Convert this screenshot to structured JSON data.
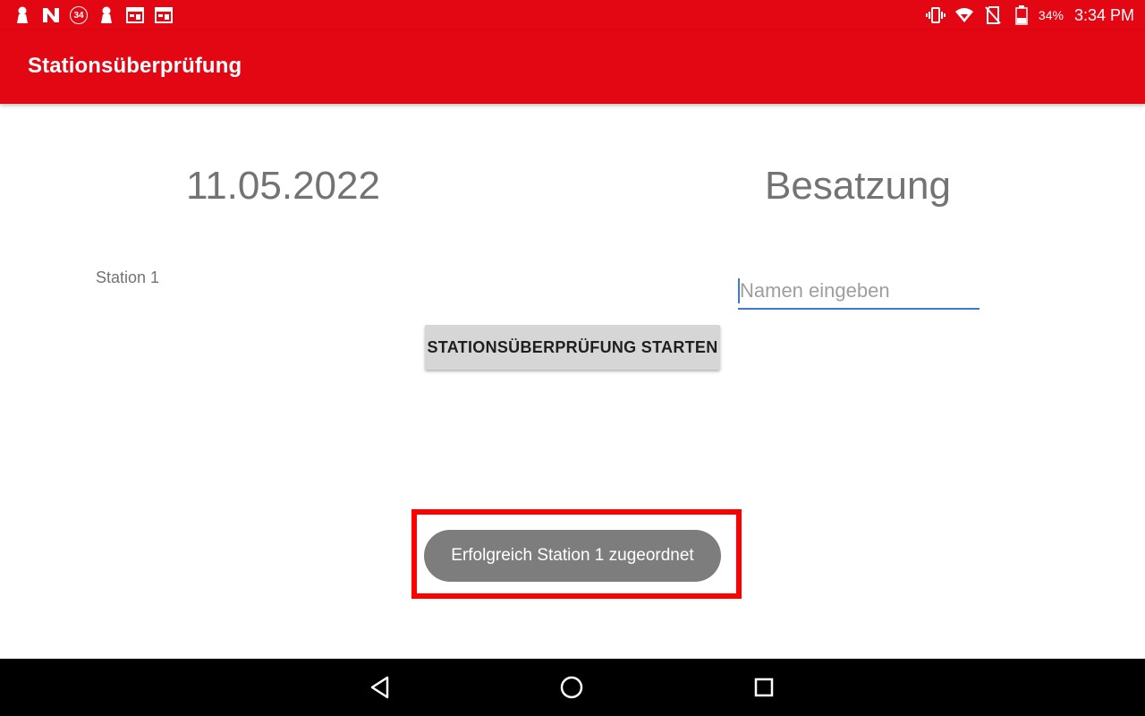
{
  "status_bar": {
    "notification_icons": [
      "keyhole-icon",
      "n-app-icon",
      "badge-34-icon",
      "keyhole-icon",
      "calendar-icon",
      "calendar-icon"
    ],
    "badge_count": "34",
    "system_icons": [
      "vibrate-icon",
      "wifi-icon",
      "no-sim-icon",
      "battery-icon"
    ],
    "battery_percent": "34%",
    "time": "3:34 PM"
  },
  "app_bar": {
    "title": "Stationsüberprüfung"
  },
  "main": {
    "date": "11.05.2022",
    "crew_heading": "Besatzung",
    "station_label": "Station 1",
    "name_input": {
      "value": "",
      "placeholder": "Namen eingeben"
    },
    "start_button_label": "STATIONSÜBERPRÜFUNG STARTEN"
  },
  "toast": {
    "message": "Erfolgreich Station 1 zugeordnet"
  },
  "nav_bar": {
    "buttons": [
      "back-icon",
      "home-icon",
      "recents-icon"
    ]
  },
  "colors": {
    "brand_red": "#e30613",
    "highlight_red": "#ff0000",
    "input_accent": "#3b78d8",
    "toast_bg": "#7d7d7d",
    "button_bg": "#d6d6d6"
  }
}
